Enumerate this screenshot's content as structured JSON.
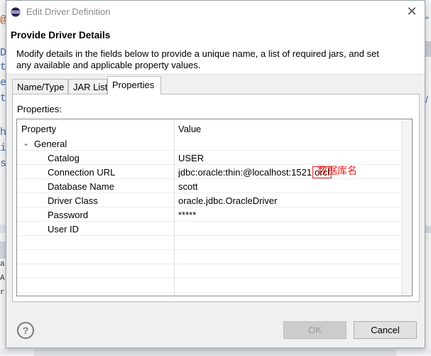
{
  "window": {
    "title": "Edit Driver Definition",
    "close_glyph": "✕"
  },
  "header": {
    "title": "Provide Driver Details",
    "description": "Modify details in the fields below to provide a unique name, a list of required jars, and set any available and applicable property values."
  },
  "tabs": [
    {
      "label": "Name/Type",
      "active": false
    },
    {
      "label": "JAR List",
      "active": false
    },
    {
      "label": "Properties",
      "active": true
    }
  ],
  "properties": {
    "label": "Properties:",
    "columns": {
      "property": "Property",
      "value": "Value"
    },
    "group": {
      "chevron": "⌄",
      "label": "General"
    },
    "rows": [
      {
        "property": "Catalog",
        "value": "USER"
      },
      {
        "property": "Connection URL",
        "value_prefix": "jdbc:oracle:thin:@localhost:1521",
        "value_highlight": "orcl"
      },
      {
        "property": "Database Name",
        "value": "scott"
      },
      {
        "property": "Driver Class",
        "value": "oracle.jdbc.OracleDriver"
      },
      {
        "property": "Password",
        "value": "*****"
      },
      {
        "property": "User ID",
        "value": ""
      }
    ],
    "annotation": "数据库名"
  },
  "footer": {
    "help_glyph": "?",
    "ok_label": "OK",
    "ok_enabled": false,
    "cancel_label": "Cancel"
  },
  "background": {
    "left_fragments": [
      "@",
      "D",
      "t",
      "e",
      "t",
      "h",
      "i",
      "s",
      "a",
      "A",
      "r"
    ],
    "right_fragments": [
      "\"",
      "/"
    ]
  }
}
